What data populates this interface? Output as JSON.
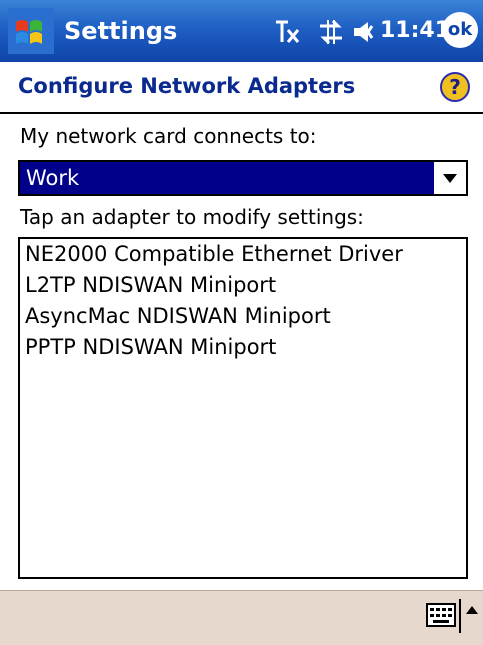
{
  "titlebar": {
    "title": "Settings",
    "time": "11:41",
    "ok_label": "ok"
  },
  "header": {
    "page_title": "Configure Network Adapters",
    "help_glyph": "?"
  },
  "connects_label": "My network card connects to:",
  "network_select": {
    "value": "Work"
  },
  "adapters_label": "Tap an adapter to modify settings:",
  "adapters": [
    "NE2000 Compatible Ethernet Driver",
    "L2TP NDISWAN Miniport",
    "AsyncMac NDISWAN Miniport",
    "PPTP NDISWAN Miniport"
  ],
  "colors": {
    "titlebar": "#1f5fc4",
    "selection": "#00008b",
    "page_title": "#0b2a8f",
    "bottombar": "#e6d8cc"
  },
  "icons": {
    "start": "windows-flag-icon",
    "signal": "antenna-off-icon",
    "connectivity": "sync-arrows-icon",
    "volume": "speaker-icon",
    "help": "help-icon",
    "keyboard": "keyboard-icon",
    "sip_toggle": "caret-up-icon"
  }
}
